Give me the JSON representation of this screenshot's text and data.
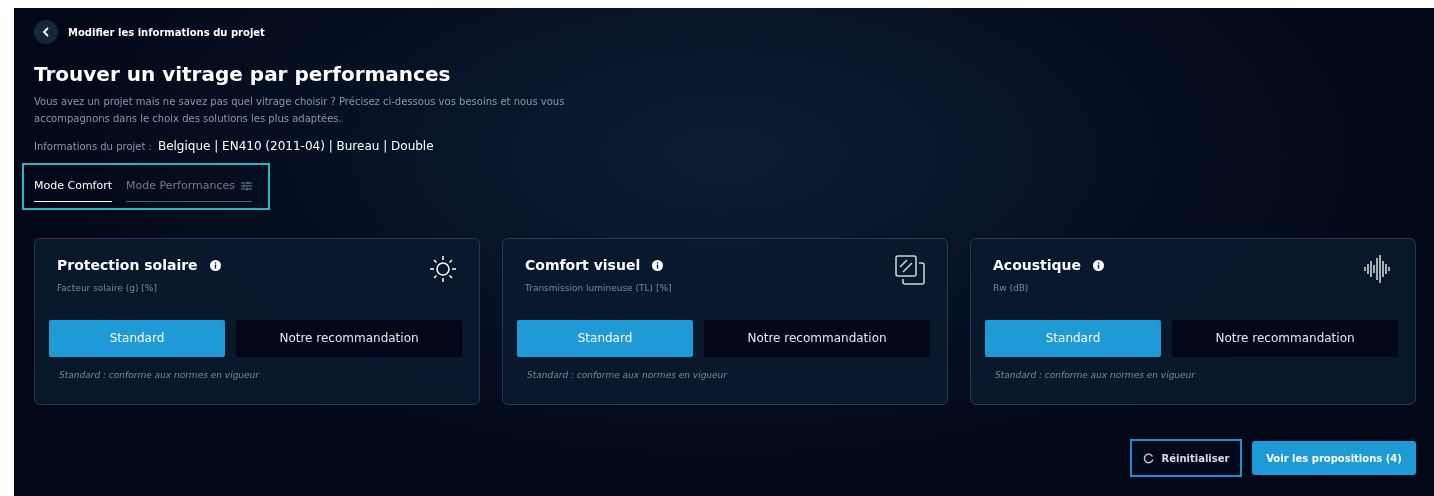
{
  "back_link": {
    "label": "Modifier les informations du projet"
  },
  "title": "Trouver un vitrage par performances",
  "description": "Vous avez un projet mais ne savez pas quel vitrage choisir ? Précisez ci-dessous vos besoins et nous vous accompagnons dans le choix des solutions les plus adaptées.",
  "project_info": {
    "label": "Informations du projet :",
    "value": "Belgique | EN410 (2011-04) | Bureau | Double"
  },
  "tabs": [
    {
      "label": "Mode Comfort",
      "selected": true
    },
    {
      "label": "Mode Performances",
      "selected": false
    }
  ],
  "cards": [
    {
      "title": "Protection solaire",
      "subtitle": "Facteur solaire (g) [%]",
      "kind": "sun",
      "options": [
        {
          "label": "Standard",
          "selected": true
        },
        {
          "label": "Notre recommandation",
          "selected": false
        }
      ],
      "note": "Standard : conforme aux normes en vigueur"
    },
    {
      "title": "Comfort visuel",
      "subtitle": "Transmission lumineuse (TL) [%]",
      "kind": "glass",
      "options": [
        {
          "label": "Standard",
          "selected": true
        },
        {
          "label": "Notre recommandation",
          "selected": false
        }
      ],
      "note": "Standard : conforme aux normes en vigueur"
    },
    {
      "title": "Acoustique",
      "subtitle": "Rw (dB)",
      "kind": "sound",
      "options": [
        {
          "label": "Standard",
          "selected": true
        },
        {
          "label": "Notre recommandation",
          "selected": false
        }
      ],
      "note": "Standard : conforme aux normes en vigueur"
    }
  ],
  "actions": {
    "reset": "Réinitialiser",
    "submit": "Voir les propositions (4)"
  }
}
